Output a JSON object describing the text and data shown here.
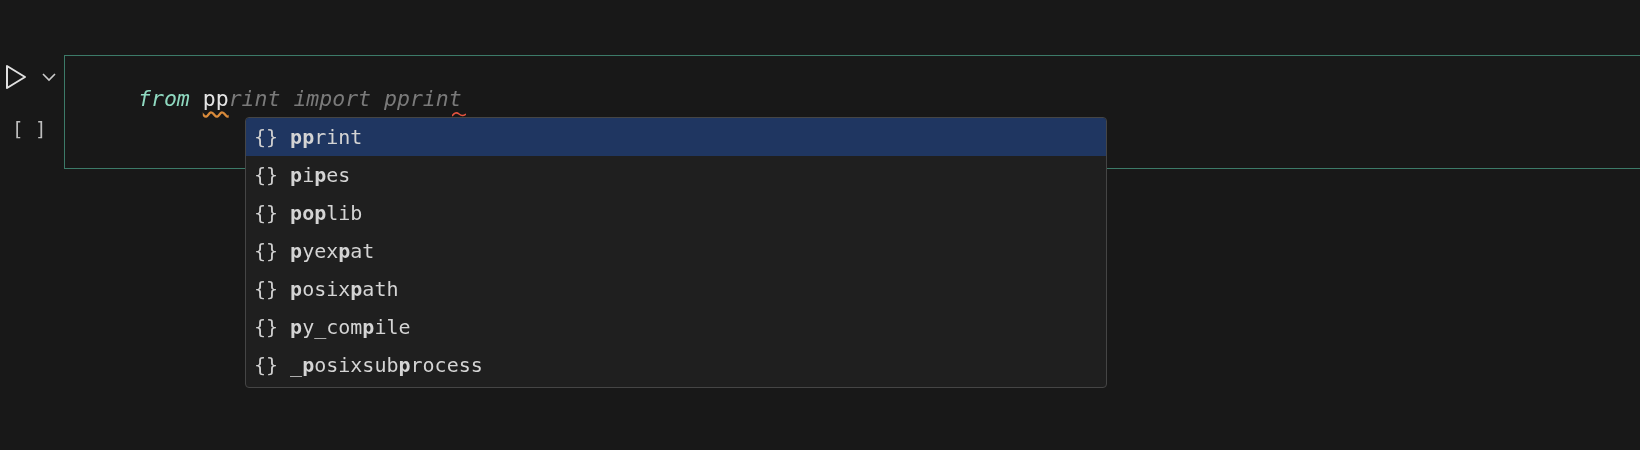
{
  "cell": {
    "execution_count": "[ ]",
    "code": {
      "keyword": "from",
      "typed": "pp",
      "ghost": "rint import pprint"
    }
  },
  "suggestions": [
    {
      "icon": "{}",
      "label": "**pp**rint",
      "selected": true
    },
    {
      "icon": "{}",
      "label": "**p**i**p**es",
      "selected": false
    },
    {
      "icon": "{}",
      "label": "**pop**lib",
      "selected": false
    },
    {
      "icon": "{}",
      "label": "**p**yex**p**at",
      "selected": false
    },
    {
      "icon": "{}",
      "label": "**p**osix**p**ath",
      "selected": false
    },
    {
      "icon": "{}",
      "label": "**p**y_com**p**ile",
      "selected": false
    },
    {
      "icon": "{}",
      "label": "_**p**osixsub**p**rocess",
      "selected": false
    }
  ]
}
